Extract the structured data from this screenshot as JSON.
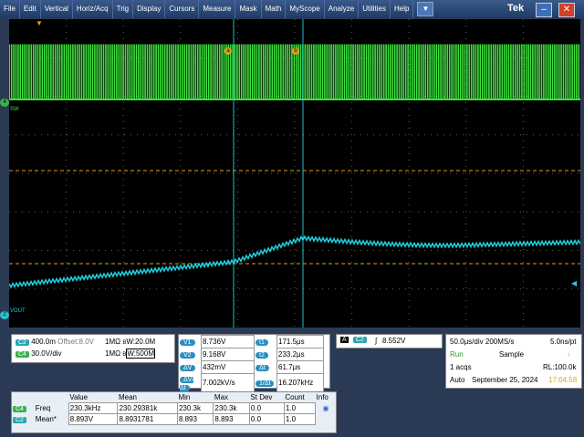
{
  "menu": [
    "File",
    "Edit",
    "Vertical",
    "Horiz/Acq",
    "Trig",
    "Display",
    "Cursors",
    "Measure",
    "Mask",
    "Math",
    "MyScope",
    "Analyze",
    "Utilities",
    "Help"
  ],
  "brand": "Tek",
  "dropdown_icon": "triangle-down-icon",
  "ch_labels": {
    "sw": "SW",
    "vout": "VOUT",
    "c1": "4",
    "c2": "2"
  },
  "cursors": {
    "a": "a",
    "b": "b"
  },
  "ch_settings": {
    "c2": {
      "tag": "C2",
      "scale": "400.0m",
      "offset": "Offset:8.0V",
      "imp": "1MΩ",
      "bw": "W:20.0M"
    },
    "c4": {
      "tag": "C4",
      "scale": "30.0V/div",
      "imp": "1MΩ",
      "bw": "W:500M"
    }
  },
  "cursor_readout": {
    "rows": [
      {
        "l": "V1",
        "v": "8.736V",
        "r": "t1",
        "rv": "171.5μs"
      },
      {
        "l": "V2",
        "v": "9.168V",
        "r": "t2",
        "rv": "233.2μs"
      },
      {
        "l": "ΔV",
        "v": "432mV",
        "r": "Δt",
        "rv": "61.7μs"
      },
      {
        "l": "ΔV/Δt",
        "v": "7.002kV/s",
        "r": "1/Δt",
        "rv": "16.207kHz"
      }
    ]
  },
  "trigger": {
    "mode": "A",
    "ch": "C2",
    "level": "8.552V"
  },
  "horiz": {
    "timebase": "50.0μs/div",
    "rate": "200MS/s",
    "pt": "5.0ns/pt",
    "state": "Run",
    "acq": "Sample",
    "acqs": "1 acqs",
    "rl": "RL:100.0k",
    "auto": "Auto",
    "date": "September 25, 2024",
    "time": "17:04:58"
  },
  "measure": {
    "headers": [
      "Value",
      "Mean",
      "Min",
      "Max",
      "St Dev",
      "Count",
      "Info"
    ],
    "rows": [
      {
        "tag": "C4",
        "name": "Freq",
        "value": "230.3kHz",
        "mean": "230.29381k",
        "min": "230.3k",
        "max": "230.3k",
        "sd": "0.0",
        "count": "1.0"
      },
      {
        "tag": "C2",
        "name": "Mean*",
        "value": "8.893V",
        "mean": "8.8931781",
        "min": "8.893",
        "max": "8.893",
        "sd": "0.0",
        "count": "1.0"
      }
    ]
  },
  "colors": {
    "ch2": "#20d0e0",
    "ch4": "#40e040",
    "cursor": "#e0a020",
    "grid": "#606060"
  }
}
